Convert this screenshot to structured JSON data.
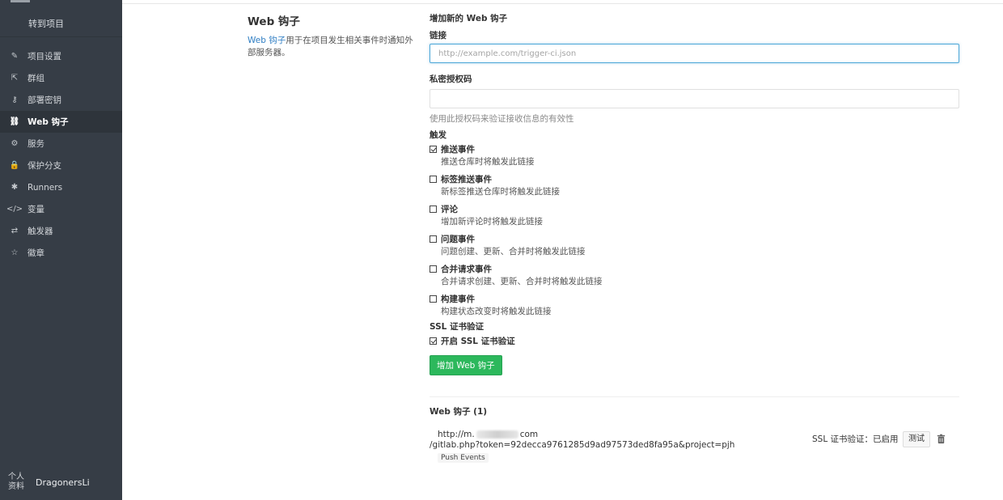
{
  "sidebar": {
    "back_label": "转到项目",
    "items": [
      {
        "label": "项目设置",
        "icon": "edit-icon",
        "glyph": "✎"
      },
      {
        "label": "群组",
        "icon": "share-icon",
        "glyph": "⇱"
      },
      {
        "label": "部署密钥",
        "icon": "key-icon",
        "glyph": "⚷"
      },
      {
        "label": "Web 钩子",
        "icon": "link-icon",
        "glyph": "⛓"
      },
      {
        "label": "服务",
        "icon": "cogs-icon",
        "glyph": "⚙"
      },
      {
        "label": "保护分支",
        "icon": "lock-icon",
        "glyph": "🔒"
      },
      {
        "label": "Runners",
        "icon": "gear-icon",
        "glyph": "✱"
      },
      {
        "label": "变量",
        "icon": "code-icon",
        "glyph": "</>"
      },
      {
        "label": "触发器",
        "icon": "retweet-icon",
        "glyph": "⇄"
      },
      {
        "label": "徽章",
        "icon": "star-icon",
        "glyph": "☆"
      }
    ],
    "active_index": 3,
    "profile_small": "个人资料",
    "username": "DragonersLi"
  },
  "intro": {
    "title": "Web 钩子",
    "link_text": "Web 钩子",
    "text": "用于在项目发生相关事件时通知外部服务器。"
  },
  "form": {
    "section_title": "增加新的 Web 钩子",
    "url_label": "链接",
    "url_placeholder": "http://example.com/trigger-ci.json",
    "url_value": "",
    "token_label": "私密授权码",
    "token_value": "",
    "token_hint": "使用此授权码来验证接收信息的有效性",
    "trigger_label": "触发",
    "triggers": [
      {
        "label": "推送事件",
        "desc": "推送仓库时将触发此链接",
        "checked": true
      },
      {
        "label": "标签推送事件",
        "desc": "新标签推送仓库时将触发此链接",
        "checked": false
      },
      {
        "label": "评论",
        "desc": "增加新评论时将触发此链接",
        "checked": false
      },
      {
        "label": "问题事件",
        "desc": "问题创建、更新、合并时将触发此链接",
        "checked": false
      },
      {
        "label": "合并请求事件",
        "desc": "合并请求创建、更新、合并时将触发此链接",
        "checked": false
      },
      {
        "label": "构建事件",
        "desc": "构建状态改变时将触发此链接",
        "checked": false
      }
    ],
    "ssl_label": "SSL 证书验证",
    "ssl_option": "开启 SSL 证书验证",
    "ssl_checked": true,
    "submit_label": "增加 Web 钩子"
  },
  "hooks": {
    "title": "Web 钩子 (1)",
    "list": [
      {
        "url_prefix": "http://m.",
        "url_suffix": "com",
        "url_path": "/gitlab.php?token=92decca9761285d9ad97573ded8fa95a&project=pjh",
        "events": "Push Events",
        "ssl_status": "SSL 证书验证：已启用",
        "test_label": "测试"
      }
    ]
  },
  "colors": {
    "sidebar_bg": "#363d46",
    "accent_green": "#2cb85c",
    "link_blue": "#2f7ec3"
  }
}
